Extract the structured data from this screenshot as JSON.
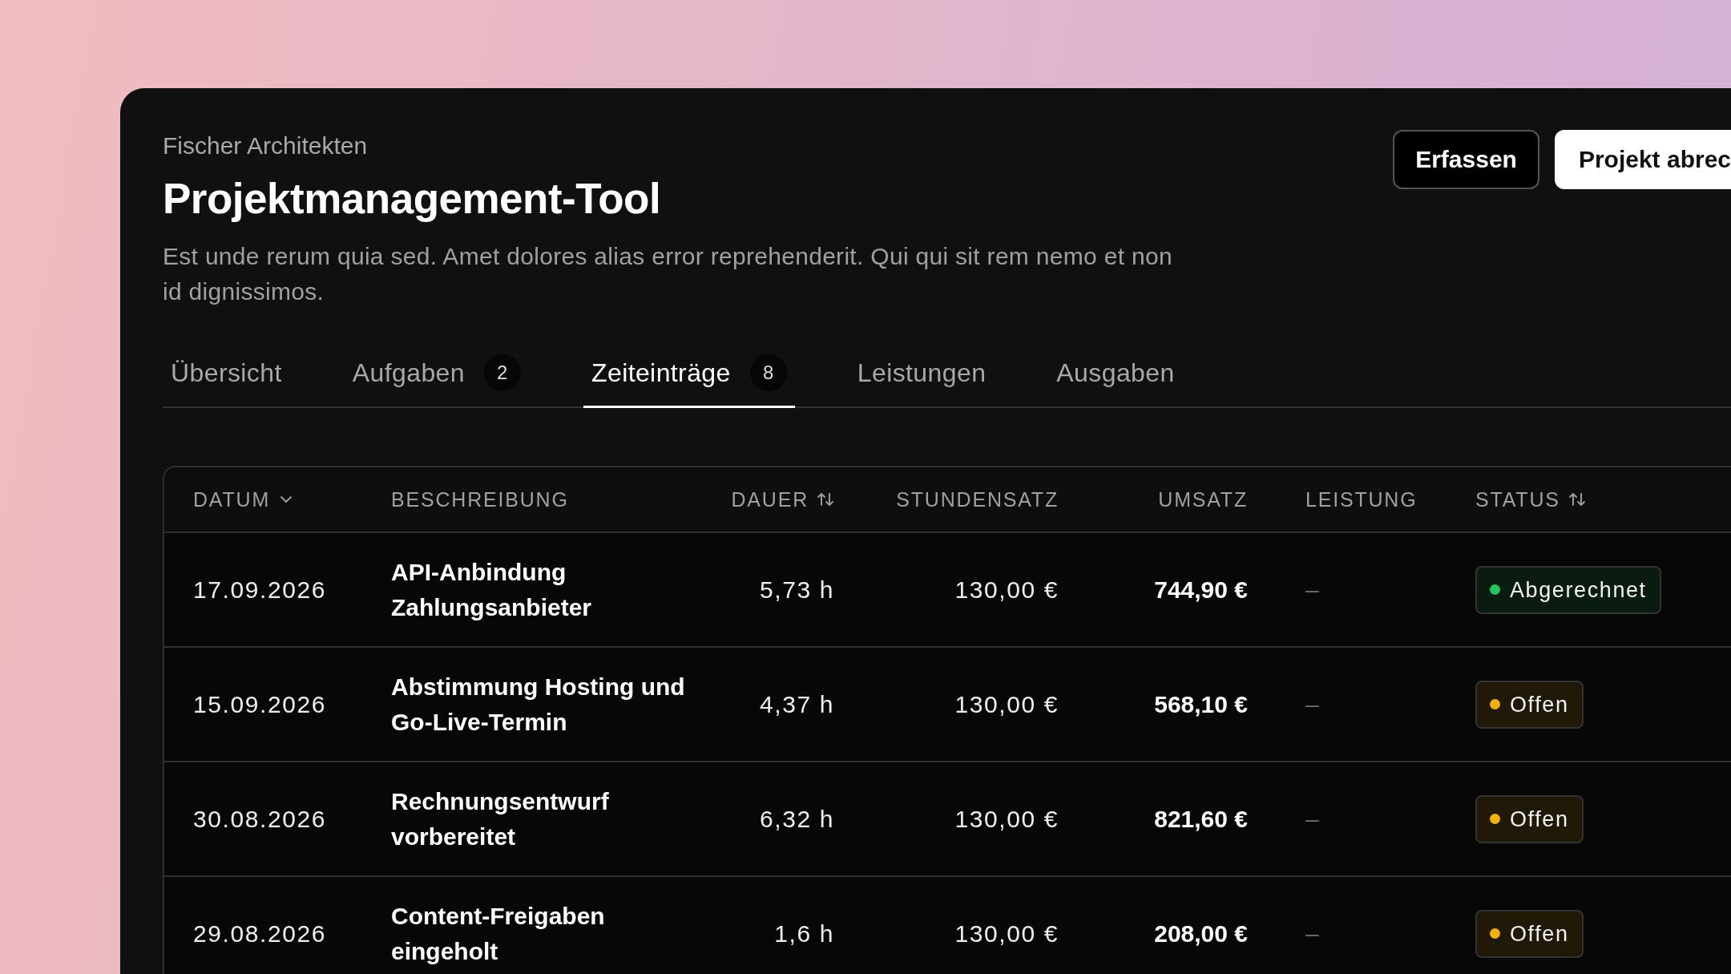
{
  "header": {
    "company": "Fischer Architekten",
    "title": "Projektmanagement-Tool",
    "description": "Est unde rerum quia sed. Amet dolores alias error reprehenderit. Qui qui sit rem nemo et non id dignissimos."
  },
  "buttons": [
    {
      "label": "Erfassen",
      "kind": "secondary"
    },
    {
      "label": "Projekt abrec",
      "kind": "primary"
    }
  ],
  "tabs": [
    {
      "label": "Übersicht",
      "selected": false
    },
    {
      "label": "Aufgaben",
      "count": "2",
      "selected": false
    },
    {
      "label": "Zeiteinträge",
      "count": "8",
      "selected": true
    },
    {
      "label": "Leistungen",
      "selected": false
    },
    {
      "label": "Ausgaben",
      "selected": false
    }
  ],
  "table": {
    "columns": [
      {
        "label": "DATUM",
        "sorted": true
      },
      {
        "label": "BESCHREIBUNG",
        "sorted": false,
        "sortable": false
      },
      {
        "label": "DAUER",
        "sorted": false,
        "sortable": true
      },
      {
        "label": "STUNDENSATZ",
        "sorted": false,
        "sortable": false
      },
      {
        "label": "UMSATZ",
        "sorted": false,
        "sortable": false
      },
      {
        "label": "LEISTUNG",
        "sorted": false,
        "sortable": false
      },
      {
        "label": "STATUS",
        "sorted": false,
        "sortable": true
      }
    ],
    "rows": [
      {
        "date": "17.09.2026",
        "description": "API-Anbindung Zahlungsanbieter",
        "duration": "5,73 h",
        "rate": "130,00 €",
        "revenue": "744,90 €",
        "service": "–",
        "status": {
          "label": "Abgerechnet",
          "color": "#22c55e"
        }
      },
      {
        "date": "15.09.2026",
        "description": "Abstimmung Hosting und Go-Live-Termin",
        "duration": "4,37 h",
        "rate": "130,00 €",
        "revenue": "568,10 €",
        "service": "–",
        "status": {
          "label": "Offen",
          "color": "#f5b10b"
        }
      },
      {
        "date": "30.08.2026",
        "description": "Rechnungsentwurf vorbereitet",
        "duration": "6,32 h",
        "rate": "130,00 €",
        "revenue": "821,60 €",
        "service": "–",
        "status": {
          "label": "Offen",
          "color": "#f5b10b"
        }
      },
      {
        "date": "29.08.2026",
        "description": "Content-Freigaben eingeholt",
        "duration": "1,6 h",
        "rate": "130,00 €",
        "revenue": "208,00 €",
        "service": "–",
        "status": {
          "label": "Offen",
          "color": "#f5b10b"
        }
      }
    ]
  }
}
